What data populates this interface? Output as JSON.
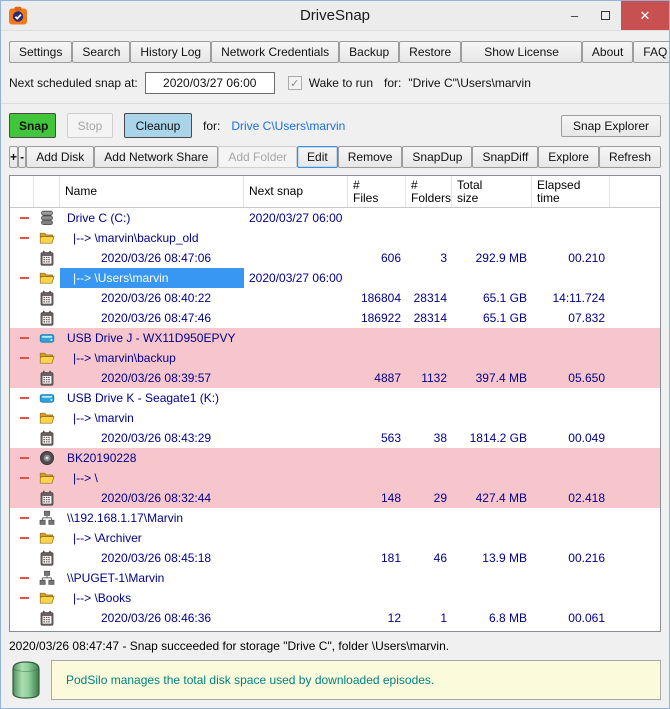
{
  "window": {
    "title": "DriveSnap",
    "minimize_glyph": "–",
    "close_glyph": "✕"
  },
  "menu_buttons": [
    "Settings",
    "Search",
    "History Log",
    "Network Credentials",
    "Backup",
    "Restore",
    "Show License",
    "About",
    "FAQ"
  ],
  "schedule": {
    "label": "Next scheduled snap at:",
    "value": "2020/03/27 06:00",
    "wake_checked_glyph": "✓",
    "wake_label": "Wake to run",
    "for_label": "for:",
    "target": "\"Drive C\"\\Users\\marvin"
  },
  "snap_bar": {
    "snap": "Snap",
    "stop": "Stop",
    "cleanup": "Cleanup",
    "for_label": "for:",
    "target": "Drive C\\Users\\marvin",
    "snap_explorer": "Snap Explorer"
  },
  "tool_bar": [
    {
      "label": "+",
      "name": "expand-all-button"
    },
    {
      "label": "-",
      "name": "collapse-all-button"
    },
    {
      "label": "Add Disk"
    },
    {
      "label": "Add Network Share"
    },
    {
      "label": "Add Folder",
      "disabled": true
    },
    {
      "label": "Edit",
      "focused": true
    },
    {
      "label": "Remove"
    },
    {
      "label": "SnapDup"
    },
    {
      "label": "SnapDiff"
    },
    {
      "label": "Explore"
    },
    {
      "label": "Refresh"
    }
  ],
  "table": {
    "headers": {
      "name": "Name",
      "next": "Next snap",
      "files": "#\nFiles",
      "folders": "#\nFolders",
      "size": "Total\nsize",
      "elapsed": "Elapsed\ntime"
    },
    "rows": [
      {
        "exp": true,
        "icon": "drive-icon",
        "level": 0,
        "name": "Drive C (C:)",
        "next": "2020/03/27 06:00"
      },
      {
        "exp": true,
        "icon": "folder-icon",
        "level": 1,
        "name": "|--> \\marvin\\backup_old"
      },
      {
        "icon": "calendar-icon",
        "level": 2,
        "name": "2020/03/26 08:47:06",
        "files": "606",
        "folders": "3",
        "size": "292.9 MB",
        "elapsed": "00.210"
      },
      {
        "exp": true,
        "icon": "folder-icon",
        "level": 1,
        "name": "|--> \\Users\\marvin",
        "next": "2020/03/27 06:00",
        "selected": true
      },
      {
        "icon": "calendar-icon",
        "level": 2,
        "name": "2020/03/26 08:40:22",
        "files": "186804",
        "folders": "28314",
        "size": "65.1 GB",
        "elapsed": "14:11.724"
      },
      {
        "icon": "calendar-icon",
        "level": 2,
        "name": "2020/03/26 08:47:46",
        "files": "186922",
        "folders": "28314",
        "size": "65.1 GB",
        "elapsed": "07.832"
      },
      {
        "exp": true,
        "icon": "usb-drive-icon",
        "level": 0,
        "name": "USB Drive J - WX11D950EPVY",
        "bg": "pink"
      },
      {
        "exp": true,
        "icon": "folder-icon",
        "level": 1,
        "name": "|--> \\marvin\\backup",
        "bg": "pink"
      },
      {
        "icon": "calendar-icon",
        "level": 2,
        "name": "2020/03/26 08:39:57",
        "files": "4887",
        "folders": "1132",
        "size": "397.4 MB",
        "elapsed": "05.650",
        "bg": "pink"
      },
      {
        "exp": true,
        "icon": "usb-drive-icon",
        "level": 0,
        "name": "USB Drive K - Seagate1 (K:)"
      },
      {
        "exp": true,
        "icon": "folder-icon",
        "level": 1,
        "name": "|--> \\marvin"
      },
      {
        "icon": "calendar-icon",
        "level": 2,
        "name": "2020/03/26 08:43:29",
        "files": "563",
        "folders": "38",
        "size": "1814.2 GB",
        "elapsed": "00.049"
      },
      {
        "exp": true,
        "icon": "disc-icon",
        "level": 0,
        "name": "BK20190228",
        "bg": "pink"
      },
      {
        "exp": true,
        "icon": "folder-icon",
        "level": 1,
        "name": "|--> \\",
        "bg": "pink"
      },
      {
        "icon": "calendar-icon",
        "level": 2,
        "name": "2020/03/26 08:32:44",
        "files": "148",
        "folders": "29",
        "size": "427.4 MB",
        "elapsed": "02.418",
        "bg": "pink"
      },
      {
        "exp": true,
        "icon": "network-icon",
        "level": 0,
        "name": "\\\\192.168.1.17\\Marvin"
      },
      {
        "exp": true,
        "icon": "folder-icon",
        "level": 1,
        "name": "|--> \\Archiver"
      },
      {
        "icon": "calendar-icon",
        "level": 2,
        "name": "2020/03/26 08:45:18",
        "files": "181",
        "folders": "46",
        "size": "13.9 MB",
        "elapsed": "00.216"
      },
      {
        "exp": true,
        "icon": "network-icon",
        "level": 0,
        "name": "\\\\PUGET-1\\Marvin"
      },
      {
        "exp": true,
        "icon": "folder-icon",
        "level": 1,
        "name": "|--> \\Books"
      },
      {
        "icon": "calendar-icon",
        "level": 2,
        "name": "2020/03/26 08:46:36",
        "files": "12",
        "folders": "1",
        "size": "6.8 MB",
        "elapsed": "00.061"
      }
    ]
  },
  "status": "2020/03/26 08:47:47 - Snap succeeded for storage \"Drive C\", folder \\Users\\marvin.",
  "banner": {
    "text": "PodSilo manages the total disk space used by downloaded episodes.",
    "icon": "silo-icon"
  },
  "colors": {
    "snap_green": "#41c63b",
    "cleanup_blue": "#a9d4ea",
    "selection_blue": "#3797f2",
    "warning_pink": "#f7c6cd",
    "table_text_navy": "#00008b",
    "link_blue": "#1a6fe0",
    "banner_teal": "#008080",
    "close_red": "#c75050",
    "expander_red": "#e25048"
  }
}
